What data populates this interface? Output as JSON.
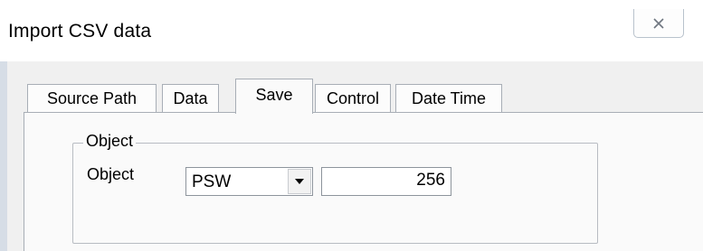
{
  "window": {
    "title": "Import CSV data",
    "close_icon": "close-icon"
  },
  "tabs": [
    {
      "label": "Source Path",
      "active": false
    },
    {
      "label": "Data",
      "active": false
    },
    {
      "label": "Save",
      "active": true
    },
    {
      "label": "Control",
      "active": false
    },
    {
      "label": "Date Time",
      "active": false
    }
  ],
  "object_group": {
    "legend": "Object",
    "object_label": "Object",
    "object_type": {
      "selected": "PSW",
      "dropdown_icon": "chevron-down-icon"
    },
    "object_address": "256"
  }
}
